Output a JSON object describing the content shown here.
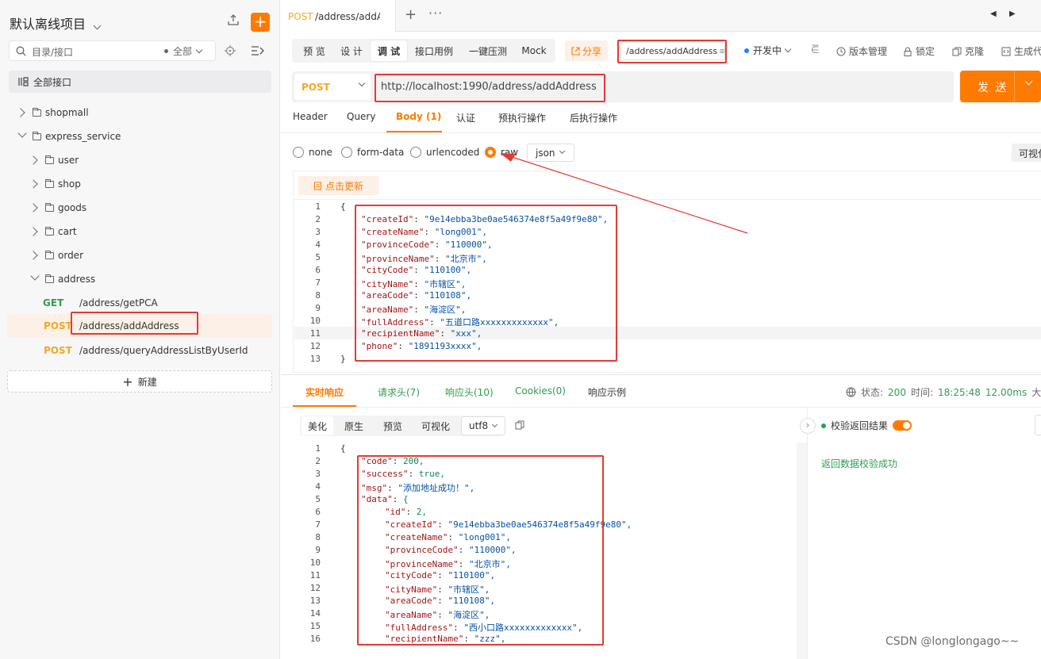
{
  "project": {
    "title": "默认离线项目"
  },
  "search": {
    "placeholder": "目录/接口",
    "filter": "全部"
  },
  "sidebar": {
    "all_label": "全部接口",
    "tree": [
      {
        "label": "shopmall"
      },
      {
        "label": "express_service"
      },
      {
        "label": "user"
      },
      {
        "label": "shop"
      },
      {
        "label": "goods"
      },
      {
        "label": "cart"
      },
      {
        "label": "order"
      },
      {
        "label": "address"
      }
    ],
    "endpoints": [
      {
        "method": "GET",
        "path": "/address/getPCA"
      },
      {
        "method": "POST",
        "path": "/address/addAddress"
      },
      {
        "method": "POST",
        "path": "/address/queryAddressListByUserId"
      }
    ],
    "new_label": "新建"
  },
  "tab": {
    "method": "POST",
    "name": "/address/addAc"
  },
  "toolbar": {
    "modes": [
      "预 览",
      "设 计",
      "调 试",
      "接口用例",
      "一键压测",
      "Mock"
    ],
    "share": "分享",
    "path": "/address/addAddress",
    "env": "开发中",
    "version": "版本管理",
    "lock": "锁定",
    "clone": "克隆",
    "gen": "生成代"
  },
  "request": {
    "method": "POST",
    "url": "http://localhost:1990/address/addAddress",
    "send": "发 送"
  },
  "request_tabs": [
    "Header",
    "Query",
    "Body (1)",
    "认证",
    "预执行操作",
    "后执行操作"
  ],
  "body_types": [
    "none",
    "form-data",
    "urlencoded",
    "raw"
  ],
  "body_format": "json",
  "visualize": "可视化",
  "refresh": "点击更新",
  "request_body": [
    {
      "n": "1",
      "t": "{"
    },
    {
      "n": "2",
      "k": "\"createId\"",
      "v": "\"9e14ebba3be0ae546374e8f5a49f9e80\","
    },
    {
      "n": "3",
      "k": "\"createName\"",
      "v": "\"long001\","
    },
    {
      "n": "4",
      "k": "\"provinceCode\"",
      "v": "\"110000\","
    },
    {
      "n": "5",
      "k": "\"provinceName\"",
      "v": "\"北京市\","
    },
    {
      "n": "6",
      "k": "\"cityCode\"",
      "v": "\"110100\","
    },
    {
      "n": "7",
      "k": "\"cityName\"",
      "v": "\"市辖区\","
    },
    {
      "n": "8",
      "k": "\"areaCode\"",
      "v": "\"110108\","
    },
    {
      "n": "9",
      "k": "\"areaName\"",
      "v": "\"海淀区\","
    },
    {
      "n": "10",
      "k": "\"fullAddress\"",
      "v": "\"五道口路xxxxxxxxxxxxx\","
    },
    {
      "n": "11",
      "k": "\"recipientName\"",
      "v": "\"xxx\","
    },
    {
      "n": "12",
      "k": "\"phone\"",
      "v": "\"1891193xxxx\","
    },
    {
      "n": "13",
      "t": "}"
    }
  ],
  "response_tabs": [
    "实时响应",
    "请求头(7)",
    "响应头(10)",
    "Cookies(0)",
    "响应示例"
  ],
  "response_status": {
    "label": "状态:",
    "code": "200",
    "time_label": "时间:",
    "time": "18:25:48",
    "duration": "12.00ms",
    "size": "大"
  },
  "response_views": [
    "美化",
    "原生",
    "预览",
    "可视化"
  ],
  "response_encoding": "utf8",
  "response_body": [
    {
      "n": "1",
      "t": "{"
    },
    {
      "n": "2",
      "k": "\"code\"",
      "v": "200,"
    },
    {
      "n": "3",
      "k": "\"success\"",
      "v": "true,"
    },
    {
      "n": "4",
      "k": "\"msg\"",
      "v": "\"添加地址成功！\","
    },
    {
      "n": "5",
      "k": "\"data\"",
      "v": "{"
    },
    {
      "n": "6",
      "k": "\"id\"",
      "v": "2,"
    },
    {
      "n": "7",
      "k": "\"createId\"",
      "v": "\"9e14ebba3be0ae546374e8f5a49f9e80\","
    },
    {
      "n": "8",
      "k": "\"createName\"",
      "v": "\"long001\","
    },
    {
      "n": "9",
      "k": "\"provinceCode\"",
      "v": "\"110000\","
    },
    {
      "n": "10",
      "k": "\"provinceName\"",
      "v": "\"北京市\","
    },
    {
      "n": "11",
      "k": "\"cityCode\"",
      "v": "\"110100\","
    },
    {
      "n": "12",
      "k": "\"cityName\"",
      "v": "\"市辖区\","
    },
    {
      "n": "13",
      "k": "\"areaCode\"",
      "v": "\"110108\","
    },
    {
      "n": "14",
      "k": "\"areaName\"",
      "v": "\"海淀区\","
    },
    {
      "n": "15",
      "k": "\"fullAddress\"",
      "v": "\"西小口路xxxxxxxxxxxxx\","
    },
    {
      "n": "16",
      "k": "\"recipientName\"",
      "v": "\"zzz\","
    }
  ],
  "validation": {
    "toggle_label": "校验返回结果",
    "result": "返回数据校验成功"
  },
  "watermark": "CSDN @longlongago~~",
  "colors": {
    "accent": "#ff7a00",
    "get": "#2e9e4f",
    "post": "#f5a623",
    "annotation": "#e53935"
  }
}
